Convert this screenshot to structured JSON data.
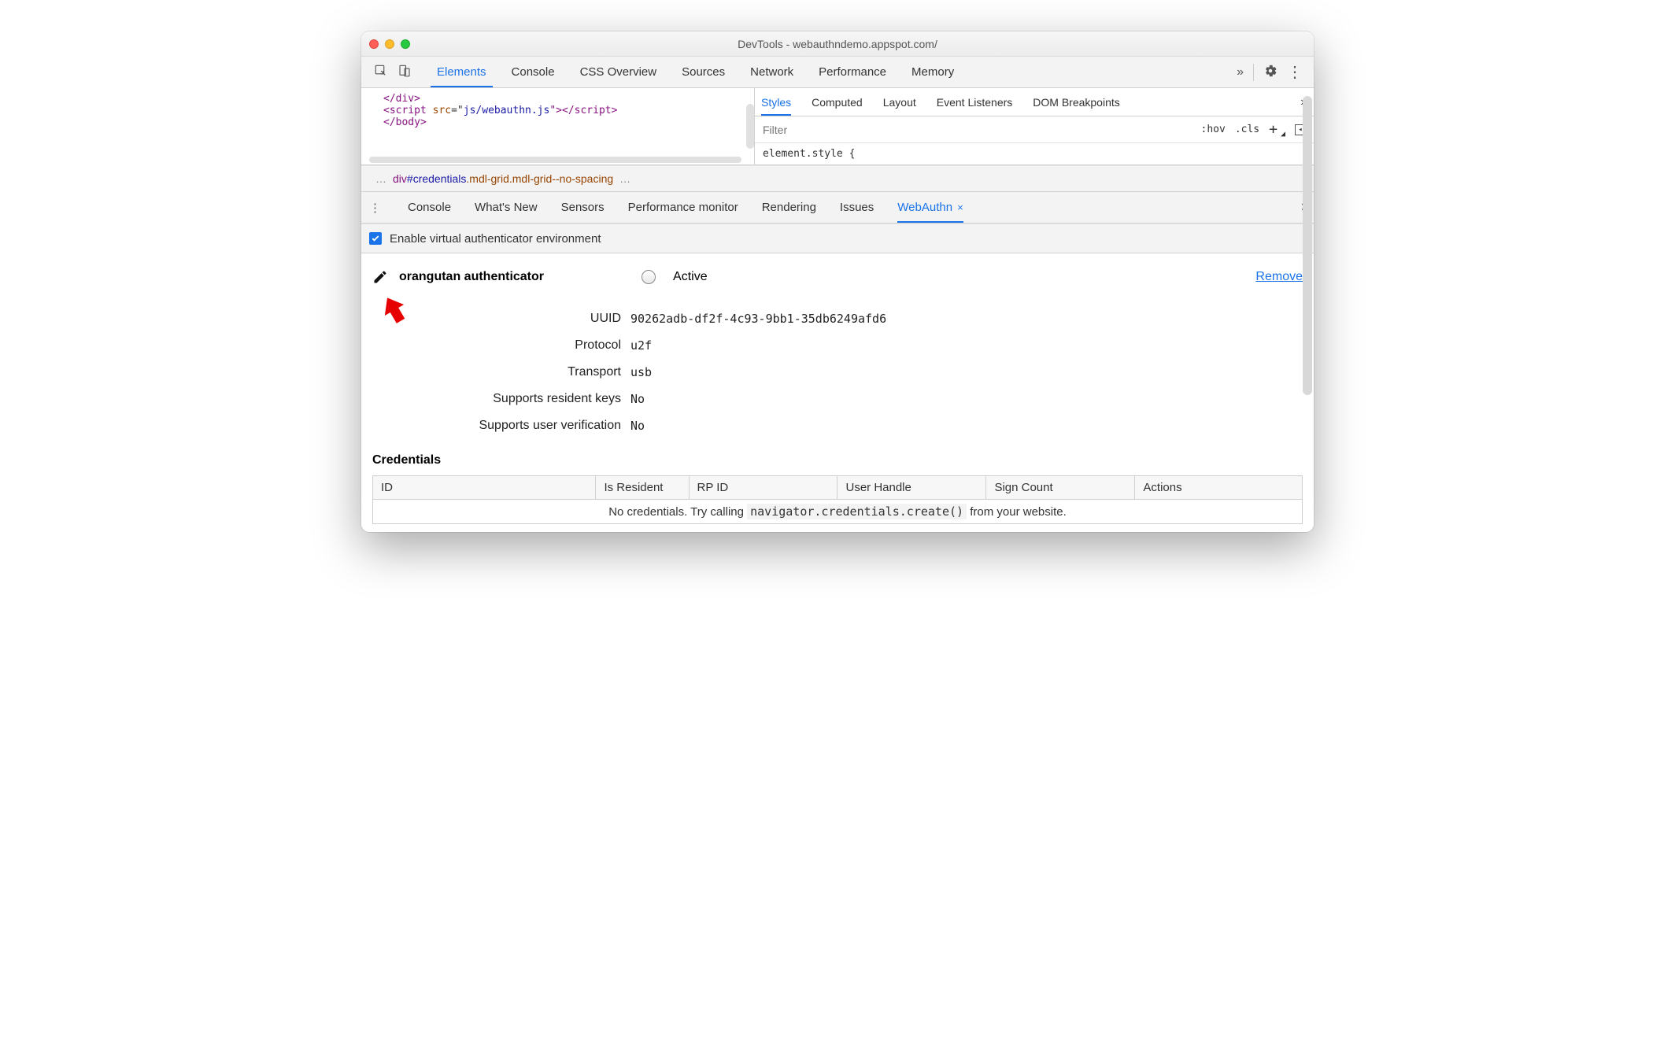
{
  "window": {
    "title": "DevTools - webauthndemo.appspot.com/"
  },
  "main_tabs": {
    "items": [
      "Elements",
      "Console",
      "CSS Overview",
      "Sources",
      "Network",
      "Performance",
      "Memory"
    ],
    "active": "Elements",
    "more_glyph": "»"
  },
  "code": {
    "l1_tag_end": "</div>",
    "l2_open": "<script ",
    "l2_attr": "src",
    "l2_eq": "=\"",
    "l2_val": "js/webauthn.js",
    "l2_close": "\"></scr",
    "l2_close2": "ipt>",
    "l3": "</body>"
  },
  "styles_tabs": {
    "items": [
      "Styles",
      "Computed",
      "Layout",
      "Event Listeners",
      "DOM Breakpoints"
    ],
    "active": "Styles",
    "more_glyph": "»"
  },
  "styles_filter": {
    "placeholder": "Filter",
    "hov": ":hov",
    "cls": ".cls",
    "plus": "+",
    "panel_glyph": "◨",
    "corner": "◢"
  },
  "element_style": "element.style {",
  "breadcrumb": {
    "left_ell": "…",
    "tag": "div",
    "id": "#credentials",
    "cls1": ".mdl-grid",
    "cls2": ".mdl-grid--no-spacing",
    "right_ell": "…"
  },
  "drawer": {
    "items": [
      "Console",
      "What's New",
      "Sensors",
      "Performance monitor",
      "Rendering",
      "Issues",
      "WebAuthn"
    ],
    "active": "WebAuthn",
    "more_glyph": "⋮",
    "tab_close": "×",
    "panel_close": "×"
  },
  "enable": {
    "label": "Enable virtual authenticator environment",
    "checked": true
  },
  "authenticator": {
    "name": "orangutan authenticator",
    "active_label": "Active",
    "remove_label": "Remove",
    "props": [
      {
        "label": "UUID",
        "value": "90262adb-df2f-4c93-9bb1-35db6249afd6"
      },
      {
        "label": "Protocol",
        "value": "u2f"
      },
      {
        "label": "Transport",
        "value": "usb"
      },
      {
        "label": "Supports resident keys",
        "value": "No"
      },
      {
        "label": "Supports user verification",
        "value": "No"
      }
    ]
  },
  "credentials": {
    "heading": "Credentials",
    "columns": [
      "ID",
      "Is Resident",
      "RP ID",
      "User Handle",
      "Sign Count",
      "Actions"
    ],
    "empty_pre": "No credentials. Try calling ",
    "empty_code": "navigator.credentials.create()",
    "empty_post": " from your website."
  }
}
